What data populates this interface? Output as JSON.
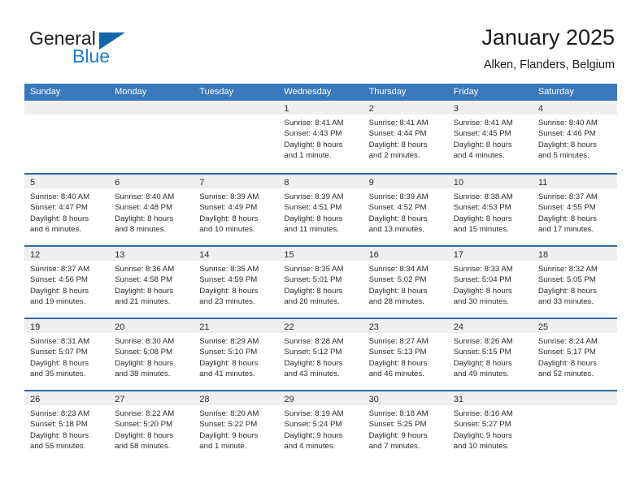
{
  "brand": {
    "name_part1": "General",
    "name_part2": "Blue",
    "logo_icon": "triangle-logo-icon"
  },
  "header": {
    "title": "January 2025",
    "location": "Alken, Flanders, Belgium"
  },
  "colors": {
    "header_blue": "#3b79bd",
    "row_divider_blue": "#2f6da8",
    "date_band_gray": "#efefef",
    "brand_blue": "#1b7fd4",
    "logo_blue": "#1266ab"
  },
  "weekdays": [
    "Sunday",
    "Monday",
    "Tuesday",
    "Wednesday",
    "Thursday",
    "Friday",
    "Saturday"
  ],
  "weeks": [
    [
      {
        "date": "",
        "lines": []
      },
      {
        "date": "",
        "lines": []
      },
      {
        "date": "",
        "lines": []
      },
      {
        "date": "1",
        "lines": [
          "Sunrise: 8:41 AM",
          "Sunset: 4:43 PM",
          "Daylight: 8 hours",
          "and 1 minute."
        ]
      },
      {
        "date": "2",
        "lines": [
          "Sunrise: 8:41 AM",
          "Sunset: 4:44 PM",
          "Daylight: 8 hours",
          "and 2 minutes."
        ]
      },
      {
        "date": "3",
        "lines": [
          "Sunrise: 8:41 AM",
          "Sunset: 4:45 PM",
          "Daylight: 8 hours",
          "and 4 minutes."
        ]
      },
      {
        "date": "4",
        "lines": [
          "Sunrise: 8:40 AM",
          "Sunset: 4:46 PM",
          "Daylight: 8 hours",
          "and 5 minutes."
        ]
      }
    ],
    [
      {
        "date": "5",
        "lines": [
          "Sunrise: 8:40 AM",
          "Sunset: 4:47 PM",
          "Daylight: 8 hours",
          "and 6 minutes."
        ]
      },
      {
        "date": "6",
        "lines": [
          "Sunrise: 8:40 AM",
          "Sunset: 4:48 PM",
          "Daylight: 8 hours",
          "and 8 minutes."
        ]
      },
      {
        "date": "7",
        "lines": [
          "Sunrise: 8:39 AM",
          "Sunset: 4:49 PM",
          "Daylight: 8 hours",
          "and 10 minutes."
        ]
      },
      {
        "date": "8",
        "lines": [
          "Sunrise: 8:39 AM",
          "Sunset: 4:51 PM",
          "Daylight: 8 hours",
          "and 11 minutes."
        ]
      },
      {
        "date": "9",
        "lines": [
          "Sunrise: 8:39 AM",
          "Sunset: 4:52 PM",
          "Daylight: 8 hours",
          "and 13 minutes."
        ]
      },
      {
        "date": "10",
        "lines": [
          "Sunrise: 8:38 AM",
          "Sunset: 4:53 PM",
          "Daylight: 8 hours",
          "and 15 minutes."
        ]
      },
      {
        "date": "11",
        "lines": [
          "Sunrise: 8:37 AM",
          "Sunset: 4:55 PM",
          "Daylight: 8 hours",
          "and 17 minutes."
        ]
      }
    ],
    [
      {
        "date": "12",
        "lines": [
          "Sunrise: 8:37 AM",
          "Sunset: 4:56 PM",
          "Daylight: 8 hours",
          "and 19 minutes."
        ]
      },
      {
        "date": "13",
        "lines": [
          "Sunrise: 8:36 AM",
          "Sunset: 4:58 PM",
          "Daylight: 8 hours",
          "and 21 minutes."
        ]
      },
      {
        "date": "14",
        "lines": [
          "Sunrise: 8:35 AM",
          "Sunset: 4:59 PM",
          "Daylight: 8 hours",
          "and 23 minutes."
        ]
      },
      {
        "date": "15",
        "lines": [
          "Sunrise: 8:35 AM",
          "Sunset: 5:01 PM",
          "Daylight: 8 hours",
          "and 26 minutes."
        ]
      },
      {
        "date": "16",
        "lines": [
          "Sunrise: 8:34 AM",
          "Sunset: 5:02 PM",
          "Daylight: 8 hours",
          "and 28 minutes."
        ]
      },
      {
        "date": "17",
        "lines": [
          "Sunrise: 8:33 AM",
          "Sunset: 5:04 PM",
          "Daylight: 8 hours",
          "and 30 minutes."
        ]
      },
      {
        "date": "18",
        "lines": [
          "Sunrise: 8:32 AM",
          "Sunset: 5:05 PM",
          "Daylight: 8 hours",
          "and 33 minutes."
        ]
      }
    ],
    [
      {
        "date": "19",
        "lines": [
          "Sunrise: 8:31 AM",
          "Sunset: 5:07 PM",
          "Daylight: 8 hours",
          "and 35 minutes."
        ]
      },
      {
        "date": "20",
        "lines": [
          "Sunrise: 8:30 AM",
          "Sunset: 5:08 PM",
          "Daylight: 8 hours",
          "and 38 minutes."
        ]
      },
      {
        "date": "21",
        "lines": [
          "Sunrise: 8:29 AM",
          "Sunset: 5:10 PM",
          "Daylight: 8 hours",
          "and 41 minutes."
        ]
      },
      {
        "date": "22",
        "lines": [
          "Sunrise: 8:28 AM",
          "Sunset: 5:12 PM",
          "Daylight: 8 hours",
          "and 43 minutes."
        ]
      },
      {
        "date": "23",
        "lines": [
          "Sunrise: 8:27 AM",
          "Sunset: 5:13 PM",
          "Daylight: 8 hours",
          "and 46 minutes."
        ]
      },
      {
        "date": "24",
        "lines": [
          "Sunrise: 8:26 AM",
          "Sunset: 5:15 PM",
          "Daylight: 8 hours",
          "and 49 minutes."
        ]
      },
      {
        "date": "25",
        "lines": [
          "Sunrise: 8:24 AM",
          "Sunset: 5:17 PM",
          "Daylight: 8 hours",
          "and 52 minutes."
        ]
      }
    ],
    [
      {
        "date": "26",
        "lines": [
          "Sunrise: 8:23 AM",
          "Sunset: 5:18 PM",
          "Daylight: 8 hours",
          "and 55 minutes."
        ]
      },
      {
        "date": "27",
        "lines": [
          "Sunrise: 8:22 AM",
          "Sunset: 5:20 PM",
          "Daylight: 8 hours",
          "and 58 minutes."
        ]
      },
      {
        "date": "28",
        "lines": [
          "Sunrise: 8:20 AM",
          "Sunset: 5:22 PM",
          "Daylight: 9 hours",
          "and 1 minute."
        ]
      },
      {
        "date": "29",
        "lines": [
          "Sunrise: 8:19 AM",
          "Sunset: 5:24 PM",
          "Daylight: 9 hours",
          "and 4 minutes."
        ]
      },
      {
        "date": "30",
        "lines": [
          "Sunrise: 8:18 AM",
          "Sunset: 5:25 PM",
          "Daylight: 9 hours",
          "and 7 minutes."
        ]
      },
      {
        "date": "31",
        "lines": [
          "Sunrise: 8:16 AM",
          "Sunset: 5:27 PM",
          "Daylight: 9 hours",
          "and 10 minutes."
        ]
      },
      {
        "date": "",
        "lines": []
      }
    ]
  ]
}
